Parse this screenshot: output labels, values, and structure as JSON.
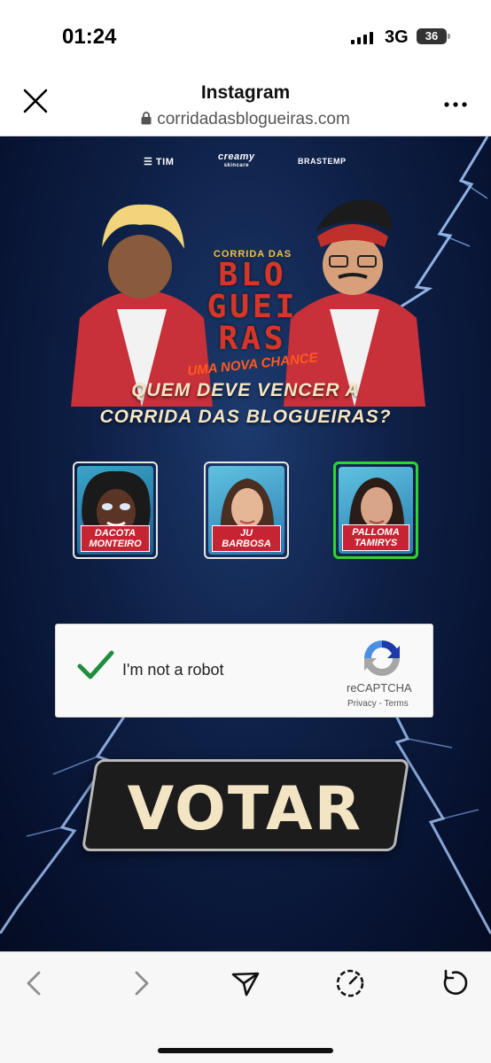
{
  "status_bar": {
    "time": "01:24",
    "network": "3G",
    "battery": "36"
  },
  "browser": {
    "title": "Instagram",
    "url": "corridadasblogueiras.com"
  },
  "page": {
    "sponsors": {
      "tim": "TIM",
      "creamy": "creamy",
      "creamy_sub": "skincare",
      "brastemp": "BRASTEMP"
    },
    "logo": {
      "top": "CORRIDA DAS",
      "line1": "BLO",
      "line2": "GUEI",
      "line3": "RAS",
      "sub": "UMA NOVA CHANCE"
    },
    "question_line1": "QUEM DEVE VENCER A",
    "question_line2": "CORRIDA DAS BLOGUEIRAS?",
    "candidates": [
      {
        "first": "DACOTA",
        "last": "MONTEIRO",
        "selected": false
      },
      {
        "first": "JU",
        "last": "BARBOSA",
        "selected": false
      },
      {
        "first": "PALLOMA",
        "last": "TAMIRYS",
        "selected": true
      }
    ],
    "recaptcha": {
      "label": "I'm not a robot",
      "brand": "reCAPTCHA",
      "privacy": "Privacy",
      "separator": " - ",
      "terms": "Terms",
      "checked": true
    },
    "vote_button": "VOTAR"
  },
  "colors": {
    "selected_border": "#2fd52f",
    "name_badge": "#c62433",
    "vote_text": "#f3e5c4",
    "check": "#1e8e3e"
  }
}
